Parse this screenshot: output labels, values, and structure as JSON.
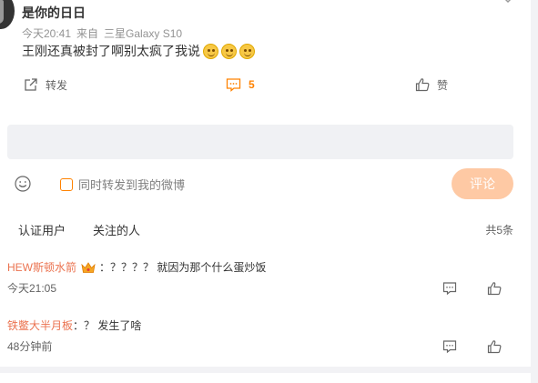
{
  "post": {
    "author": "是你的日日",
    "time": "今天20:41",
    "source_prefix": "来自",
    "source": "三星Galaxy S10",
    "text": "王刚还真被封了啊别太疯了我说",
    "emoji_count": 3
  },
  "actions": {
    "forward_label": "转发",
    "comment_count": "5",
    "like_label": "赞"
  },
  "composer": {
    "input_placeholder": "",
    "sync_label": "同时转发到我的微博",
    "submit_label": "评论"
  },
  "filters": {
    "tabs": [
      "认证用户",
      "关注的人"
    ],
    "total": "共5条"
  },
  "comments": [
    {
      "user": "HEW斯顿水箭",
      "sep": "：",
      "text": "？？？？ 就因为那个什么蛋炒饭",
      "time": "今天21:05",
      "has_badge": true
    },
    {
      "user": "铁鳖大半月板",
      "sep": "：",
      "text": "？ 发生了啥",
      "time": "48分钟前",
      "has_badge": false
    }
  ],
  "colors": {
    "accent": "#ff8200",
    "username": "#eb7350",
    "submit_disabled": "#fec9a4"
  }
}
